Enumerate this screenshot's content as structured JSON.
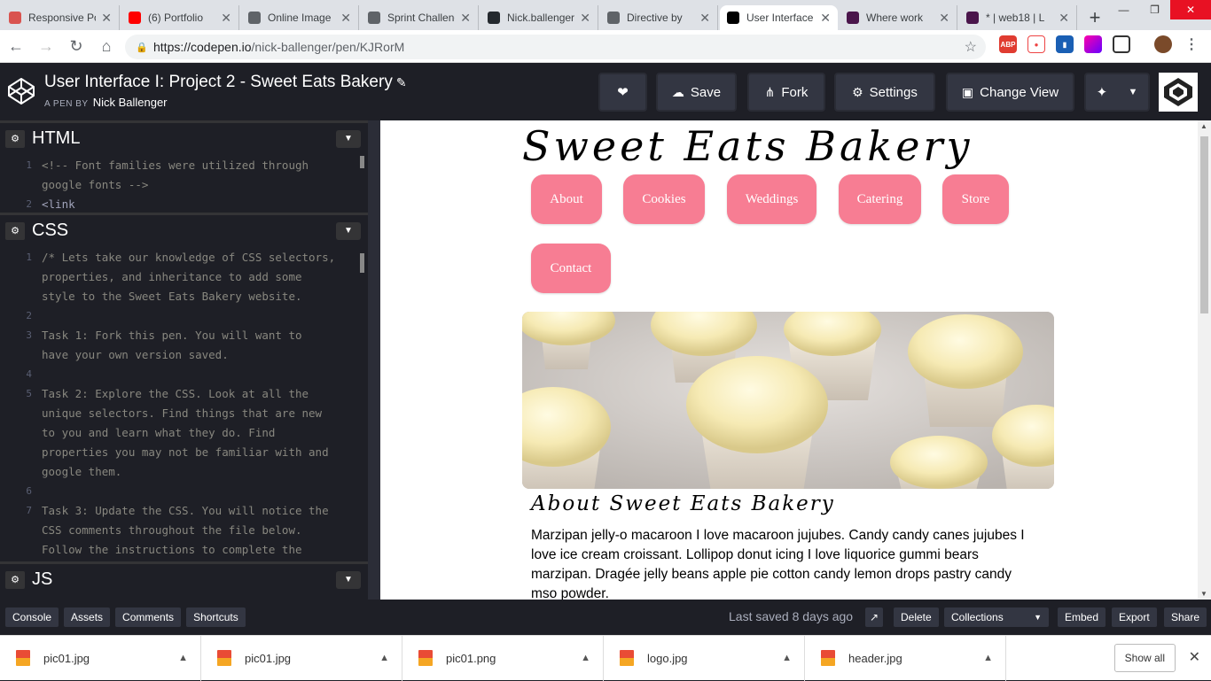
{
  "browser": {
    "tabs": [
      {
        "title": "Responsive Portfolio",
        "favicon": "shield-icon",
        "color": "#d9534f"
      },
      {
        "title": "(6) Portfolio",
        "favicon": "youtube-icon",
        "color": "#ff0000"
      },
      {
        "title": "Online Image",
        "favicon": "page-icon",
        "color": "#5f6368"
      },
      {
        "title": "Sprint Challenge",
        "favicon": "page-icon",
        "color": "#5f6368"
      },
      {
        "title": "Nick.ballenger",
        "favicon": "github-icon",
        "color": "#24292e"
      },
      {
        "title": "Directive by",
        "favicon": "page-icon",
        "color": "#5f6368"
      },
      {
        "title": "User Interface",
        "favicon": "codepen-icon",
        "color": "#000000",
        "active": true
      },
      {
        "title": "Where work",
        "favicon": "slack-icon",
        "color": "#4a154b"
      },
      {
        "title": "* | web18 | L",
        "favicon": "slack-icon",
        "color": "#4a154b"
      }
    ],
    "new_tab": "+",
    "url_host": "https://codepen.io",
    "url_path": "/nick-ballenger/pen/KJRorM"
  },
  "codepen": {
    "title": "User Interface I: Project 2 - Sweet Eats Bakery",
    "by_label": "A PEN BY",
    "author": "Nick Ballenger",
    "buttons": {
      "save": "Save",
      "fork": "Fork",
      "settings": "Settings",
      "change_view": "Change View"
    }
  },
  "editors": {
    "html": {
      "name": "HTML",
      "lines": [
        {
          "n": "1",
          "text": "<!-- Font families were utilized through"
        },
        {
          "n": "",
          "text": "google fonts -->"
        },
        {
          "n": "2",
          "text": "<link"
        }
      ]
    },
    "css": {
      "name": "CSS",
      "lines": [
        {
          "n": "1",
          "text": "/* Lets take our knowledge of CSS selectors,"
        },
        {
          "n": "",
          "text": "properties, and inheritance to add some"
        },
        {
          "n": "",
          "text": "style to the Sweet Eats Bakery website."
        },
        {
          "n": "2",
          "text": ""
        },
        {
          "n": "3",
          "text": "Task 1: Fork this pen.  You will want to"
        },
        {
          "n": "",
          "text": "have your own version saved."
        },
        {
          "n": "4",
          "text": ""
        },
        {
          "n": "5",
          "text": "Task 2: Explore the CSS.  Look at all the"
        },
        {
          "n": "",
          "text": "unique selectors.  Find things that are new"
        },
        {
          "n": "",
          "text": "to you and learn what they do.  Find"
        },
        {
          "n": "",
          "text": "properties you may not be familiar with and"
        },
        {
          "n": "",
          "text": "google them."
        },
        {
          "n": "6",
          "text": ""
        },
        {
          "n": "7",
          "text": "Task 3: Update the CSS.  You will notice the"
        },
        {
          "n": "",
          "text": "CSS comments throughout the file below."
        },
        {
          "n": "",
          "text": "Follow the instructions to complete the"
        }
      ]
    },
    "js": {
      "name": "JS"
    }
  },
  "preview": {
    "title": "Sweet Eats Bakery",
    "nav": [
      "About",
      "Cookies",
      "Weddings",
      "Catering",
      "Store",
      "Contact"
    ],
    "heading": "About Sweet Eats Bakery",
    "paragraph": "Marzipan jelly-o macaroon I love macaroon jujubes. Candy candy canes jujubes I love ice cream croissant. Lollipop donut icing I love liquorice gummi bears marzipan. Dragée jelly beans apple pie cotton candy lemon drops pastry candy mso powder.",
    "accent": "#f77d93"
  },
  "footer": {
    "left_buttons": [
      "Console",
      "Assets",
      "Comments",
      "Shortcuts"
    ],
    "saved": "Last saved 8 days ago",
    "delete": "Delete",
    "collections": "Collections",
    "embed": "Embed",
    "export": "Export",
    "share": "Share"
  },
  "downloads": {
    "files": [
      "pic01.jpg",
      "pic01.jpg",
      "pic01.png",
      "logo.jpg",
      "header.jpg"
    ],
    "show_all": "Show all"
  }
}
